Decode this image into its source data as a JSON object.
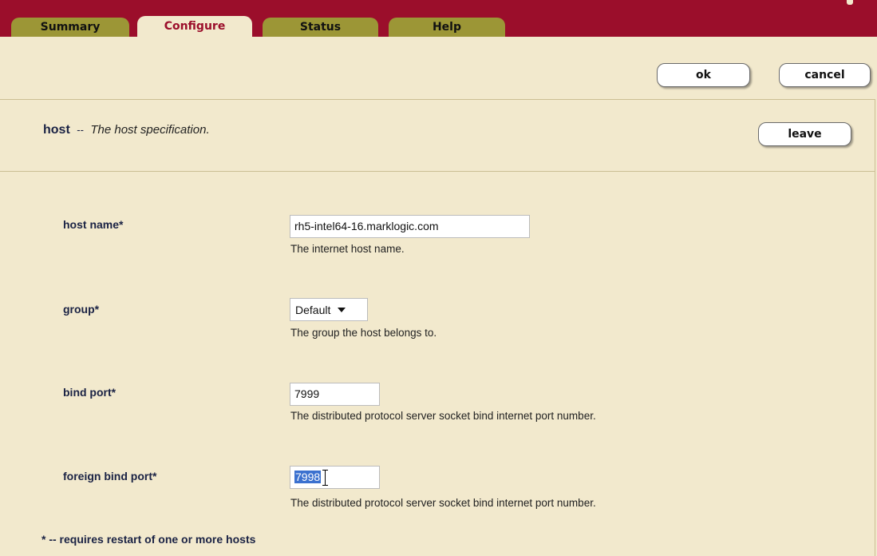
{
  "tabs": [
    {
      "label": "Summary"
    },
    {
      "label": "Configure",
      "active": true
    },
    {
      "label": "Status"
    },
    {
      "label": "Help"
    }
  ],
  "actions": {
    "ok_label": "ok",
    "cancel_label": "cancel",
    "leave_label": "leave"
  },
  "section": {
    "name": "host",
    "separator": "--",
    "description": "The host specification."
  },
  "fields": {
    "host_name": {
      "label": "host name*",
      "value": "rh5-intel64-16.marklogic.com",
      "hint": "The internet host name."
    },
    "group": {
      "label": "group*",
      "value": "Default",
      "hint": "The group the host belongs to."
    },
    "bind_port": {
      "label": "bind port*",
      "value": "7999",
      "hint": "The distributed protocol server socket bind internet port number."
    },
    "foreign_bind_port": {
      "label": "foreign bind port*",
      "value": "7998",
      "hint": "The distributed protocol server socket bind internet port number."
    }
  },
  "footnote": "* -- requires restart of one or more hosts",
  "colors": {
    "brand": "#9b0e2b",
    "tab": "#9c9636",
    "background": "#f2e9cd"
  }
}
